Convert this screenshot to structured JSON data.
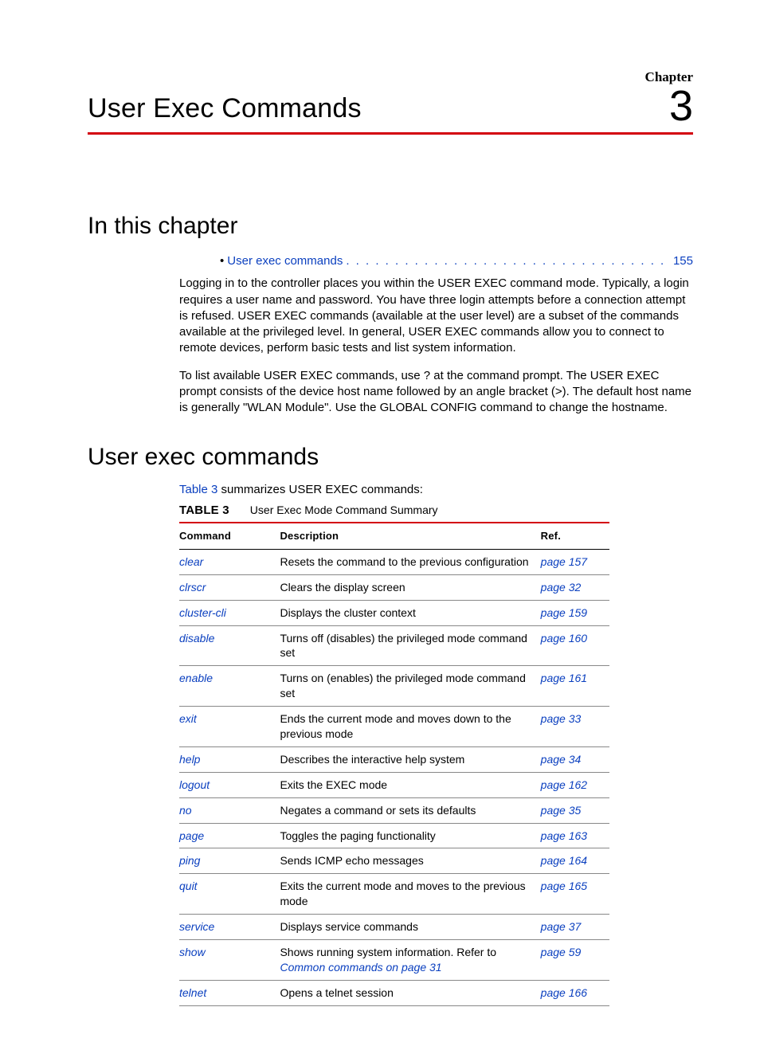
{
  "header": {
    "chapter_label": "Chapter",
    "chapter_number": "3",
    "title": "User Exec Commands"
  },
  "sections": {
    "in_this_chapter": "In this chapter",
    "user_exec_commands": "User exec commands"
  },
  "toc": {
    "bullet": "•",
    "link_text": "User exec commands",
    "page": "155"
  },
  "paragraphs": {
    "p1": "Logging in to the controller places you within the USER EXEC command mode. Typically, a login requires a user name and password. You have three login attempts before a connection attempt is refused. USER EXEC commands (available at the user level) are a subset of the commands available at the privileged level. In general, USER EXEC commands allow you to connect to remote devices, perform basic tests and list system information.",
    "p2": "To list available USER EXEC commands, use ? at the command prompt. The USER EXEC prompt consists of the device host name followed by an angle bracket (>). The default host name is generally \"WLAN Module\". Use the GLOBAL CONFIG command to change the hostname.",
    "table_intro_pre": "",
    "table_intro_link": "Table 3",
    "table_intro_post": " summarizes USER EXEC commands:"
  },
  "table": {
    "label": "TABLE 3",
    "caption": "User Exec Mode Command Summary",
    "headers": {
      "command": "Command",
      "description": "Description",
      "ref": "Ref."
    },
    "rows": [
      {
        "cmd": "clear",
        "desc": "Resets the command to the previous configuration",
        "ref": "page 157",
        "inlink": ""
      },
      {
        "cmd": "clrscr",
        "desc": "Clears the display screen",
        "ref": "page 32",
        "inlink": ""
      },
      {
        "cmd": "cluster-cli",
        "desc": "Displays the cluster context",
        "ref": "page 159",
        "inlink": ""
      },
      {
        "cmd": "disable",
        "desc": "Turns off (disables) the privileged mode command set",
        "ref": "page 160",
        "inlink": ""
      },
      {
        "cmd": "enable",
        "desc": "Turns on (enables) the privileged mode command set",
        "ref": "page 161",
        "inlink": ""
      },
      {
        "cmd": "exit",
        "desc": "Ends the current mode and moves down to the previous mode",
        "ref": "page 33",
        "inlink": ""
      },
      {
        "cmd": "help",
        "desc": "Describes the interactive help system",
        "ref": "page 34",
        "inlink": ""
      },
      {
        "cmd": "logout",
        "desc": "Exits the EXEC mode",
        "ref": "page 162",
        "inlink": ""
      },
      {
        "cmd": "no",
        "desc": "Negates a command or sets its defaults",
        "ref": "page 35",
        "inlink": ""
      },
      {
        "cmd": "page",
        "desc": "Toggles the paging functionality",
        "ref": "page 163",
        "inlink": ""
      },
      {
        "cmd": "ping",
        "desc": "Sends ICMP echo messages",
        "ref": "page 164",
        "inlink": ""
      },
      {
        "cmd": "quit",
        "desc": "Exits the current mode and moves to the previous mode",
        "ref": "page 165",
        "inlink": ""
      },
      {
        "cmd": "service",
        "desc": "Displays service commands",
        "ref": "page 37",
        "inlink": ""
      },
      {
        "cmd": "show",
        "desc": "Shows running system information. Refer to ",
        "ref": "page 59",
        "inlink": "Common commands on page 31"
      },
      {
        "cmd": "telnet",
        "desc": "Opens a telnet session",
        "ref": "page 166",
        "inlink": ""
      }
    ]
  },
  "chart_data": {
    "type": "table",
    "title": "User Exec Mode Command Summary",
    "columns": [
      "Command",
      "Description",
      "Ref."
    ],
    "rows": [
      [
        "clear",
        "Resets the command to the previous configuration",
        "page 157"
      ],
      [
        "clrscr",
        "Clears the display screen",
        "page 32"
      ],
      [
        "cluster-cli",
        "Displays the cluster context",
        "page 159"
      ],
      [
        "disable",
        "Turns off (disables) the privileged mode command set",
        "page 160"
      ],
      [
        "enable",
        "Turns on (enables) the privileged mode command set",
        "page 161"
      ],
      [
        "exit",
        "Ends the current mode and moves down to the previous mode",
        "page 33"
      ],
      [
        "help",
        "Describes the interactive help system",
        "page 34"
      ],
      [
        "logout",
        "Exits the EXEC mode",
        "page 162"
      ],
      [
        "no",
        "Negates a command or sets its defaults",
        "page 35"
      ],
      [
        "page",
        "Toggles the paging functionality",
        "page 163"
      ],
      [
        "ping",
        "Sends ICMP echo messages",
        "page 164"
      ],
      [
        "quit",
        "Exits the current mode and moves to the previous mode",
        "page 165"
      ],
      [
        "service",
        "Displays service commands",
        "page 37"
      ],
      [
        "show",
        "Shows running system information. Refer to Common commands on page 31",
        "page 59"
      ],
      [
        "telnet",
        "Opens a telnet session",
        "page 166"
      ]
    ]
  }
}
